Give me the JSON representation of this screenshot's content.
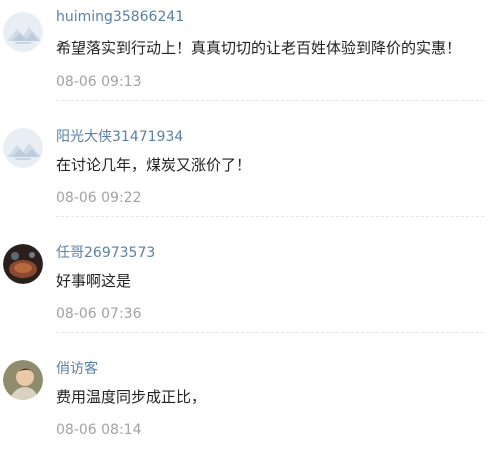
{
  "comments": [
    {
      "username": "huiming35866241",
      "text": "希望落实到行动上！真真切切的让老百姓体验到降价的实惠！",
      "time": "08-06 09:13",
      "avatar": "default-landscape-avatar"
    },
    {
      "username": "阳光大侠31471934",
      "text": "在讨论几年，煤炭又涨价了！",
      "time": "08-06 09:22",
      "avatar": "default-landscape-avatar"
    },
    {
      "username": "任哥26973573",
      "text": "好事啊这是",
      "time": "08-06 07:36",
      "avatar": "photo-avatar"
    },
    {
      "username": "俏访客",
      "text": "费用温度同步成正比，",
      "time": "08-06 08:14",
      "avatar": "photo-avatar"
    }
  ]
}
